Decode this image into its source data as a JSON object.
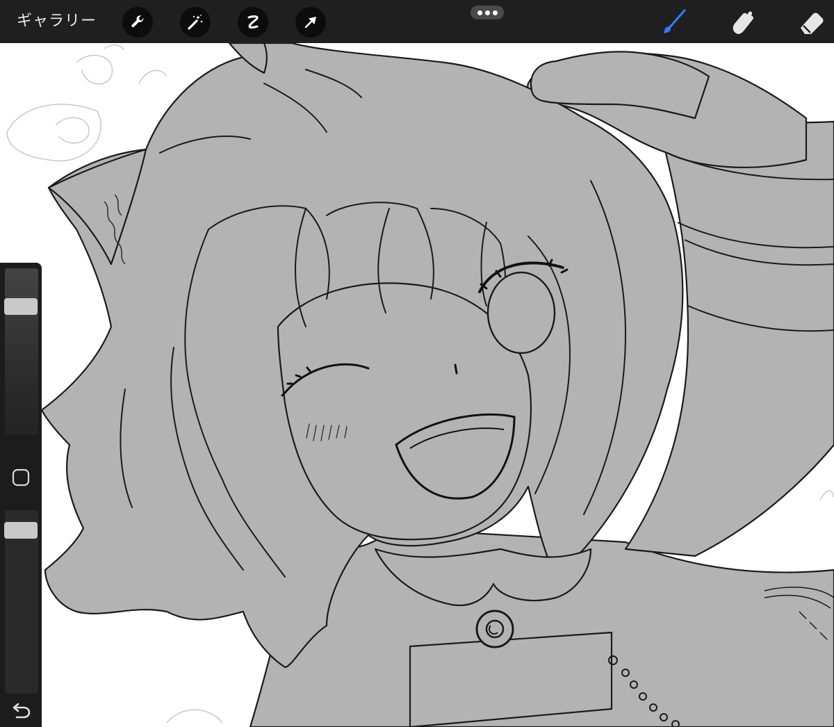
{
  "toolbar": {
    "gallery_label": "ギャラリー",
    "left_tools": [
      {
        "icon": "wrench-icon",
        "name": "actions"
      },
      {
        "icon": "magic-wand-icon",
        "name": "adjustments"
      },
      {
        "icon": "selection-icon",
        "name": "selection"
      },
      {
        "icon": "transform-arrow-icon",
        "name": "transform"
      }
    ],
    "more_icon": "more-dots-icon",
    "right_tools": [
      {
        "icon": "brush-icon",
        "name": "paint",
        "active": true
      },
      {
        "icon": "smudge-icon",
        "name": "smudge",
        "active": false
      },
      {
        "icon": "eraser-icon",
        "name": "eraser",
        "active": false
      }
    ]
  },
  "sidebar": {
    "brush_size_level": 0.8,
    "opacity_level": 0.93,
    "modify_icon": "square-modify-icon",
    "undo_icon": "undo-icon"
  },
  "colors": {
    "toolbar_bg": "#1f1f1f",
    "active_tool": "#2f7df6",
    "canvas_fill": "#b3b3b3",
    "line": "#1a1a1a"
  }
}
